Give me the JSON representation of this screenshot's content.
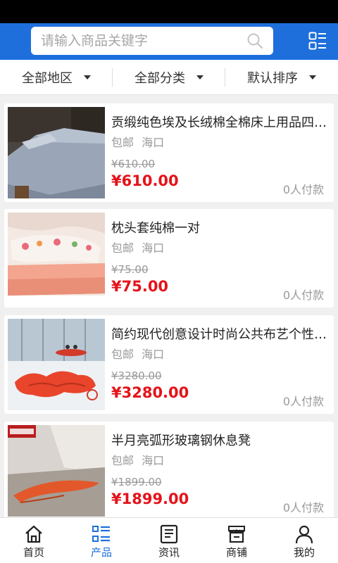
{
  "search": {
    "placeholder": "请输入商品关键字"
  },
  "filters": [
    {
      "label": "全部地区"
    },
    {
      "label": "全部分类"
    },
    {
      "label": "默认排序"
    }
  ],
  "products": [
    {
      "title": "贡缎纯色埃及长绒棉全棉床上用品四件套",
      "shipping": "包邮",
      "location": "海口",
      "old_price": "¥610.00",
      "price": "¥610.00",
      "sold": "0人付款"
    },
    {
      "title": "枕头套纯棉一对",
      "shipping": "包邮",
      "location": "海口",
      "old_price": "¥75.00",
      "price": "¥75.00",
      "sold": "0人付款"
    },
    {
      "title": "简约现代创意设计时尚公共布艺个性沙发",
      "shipping": "包邮",
      "location": "海口",
      "old_price": "¥3280.00",
      "price": "¥3280.00",
      "sold": "0人付款"
    },
    {
      "title": "半月亮弧形玻璃钢休息凳",
      "shipping": "包邮",
      "location": "海口",
      "old_price": "¥1899.00",
      "price": "¥1899.00",
      "sold": "0人付款"
    }
  ],
  "tabs": [
    {
      "label": "首页",
      "icon": "home-icon"
    },
    {
      "label": "产品",
      "icon": "list-icon"
    },
    {
      "label": "资讯",
      "icon": "news-icon"
    },
    {
      "label": "商铺",
      "icon": "store-icon"
    },
    {
      "label": "我的",
      "icon": "user-icon"
    }
  ],
  "colors": {
    "brand": "#1e6fdc",
    "price": "#e4131a",
    "muted": "#999999"
  }
}
